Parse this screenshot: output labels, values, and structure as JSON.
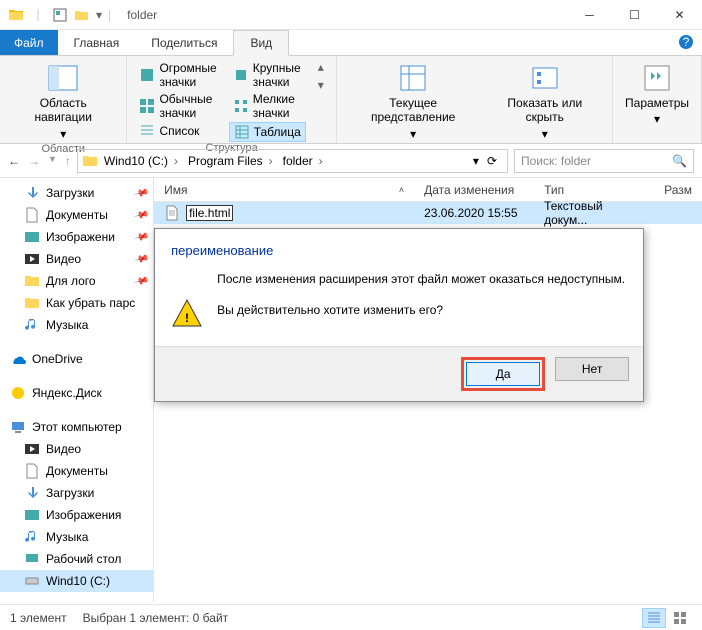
{
  "window": {
    "title": "folder"
  },
  "tabs": {
    "file": "Файл",
    "home": "Главная",
    "share": "Поделиться",
    "view": "Вид"
  },
  "ribbon": {
    "group1": {
      "navpane": "Область навигации",
      "label": "Области"
    },
    "group2": {
      "huge": "Огромные значки",
      "large": "Крупные значки",
      "normal": "Обычные значки",
      "small": "Мелкие значки",
      "list": "Список",
      "table": "Таблица",
      "label": "Структура"
    },
    "group3": {
      "curview": "Текущее представление",
      "showhide": "Показать или скрыть",
      "params": "Параметры"
    }
  },
  "breadcrumb": {
    "c1": "Wind10 (C:)",
    "c2": "Program Files",
    "c3": "folder"
  },
  "search": {
    "placeholder": "Поиск: folder"
  },
  "columns": {
    "name": "Имя",
    "date": "Дата изменения",
    "type": "Тип",
    "size": "Разм"
  },
  "file": {
    "name": "file.html",
    "date": "23.06.2020 15:55",
    "type": "Текстовый докум..."
  },
  "sidebar": {
    "downloads": "Загрузки",
    "documents": "Документы",
    "images": "Изображени",
    "video": "Видео",
    "logo": "Для лого",
    "howto": "Как убрать парс",
    "music": "Музыка",
    "onedrive": "OneDrive",
    "yandex": "Яндекс.Диск",
    "thispc": "Этот компьютер",
    "video2": "Видео",
    "documents2": "Документы",
    "downloads2": "Загрузки",
    "images2": "Изображения",
    "music2": "Музыка",
    "desktop": "Рабочий стол",
    "cdrive": "Wind10 (C:)"
  },
  "dialog": {
    "title": "переименование",
    "line1": "После изменения расширения этот файл может оказаться недоступным.",
    "line2": "Вы действительно хотите изменить его?",
    "yes": "Да",
    "no": "Нет"
  },
  "status": {
    "count": "1 элемент",
    "selected": "Выбран 1 элемент: 0 байт"
  }
}
